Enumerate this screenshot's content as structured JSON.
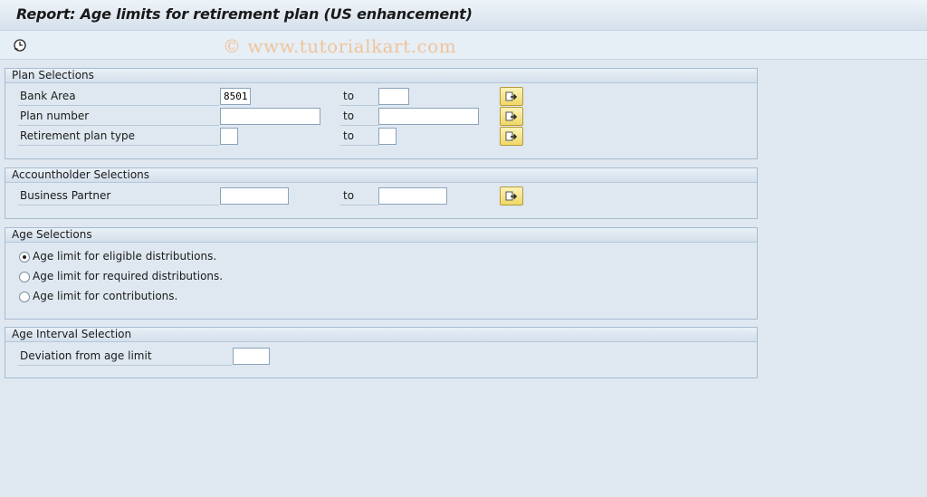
{
  "window": {
    "title": "Report: Age limits for retirement plan (US enhancement)",
    "watermark": "© www.tutorialkart.com"
  },
  "toolbar": {
    "execute_icon": "execute-clock-icon"
  },
  "plan_selections": {
    "header": "Plan Selections",
    "rows": [
      {
        "label": "Bank Area",
        "from_value": "8501",
        "to_label": "to",
        "to_value": ""
      },
      {
        "label": "Plan number",
        "from_value": "",
        "to_label": "to",
        "to_value": ""
      },
      {
        "label": "Retirement plan type",
        "from_value": "",
        "to_label": "to",
        "to_value": ""
      }
    ]
  },
  "accountholder_selections": {
    "header": "Accountholder Selections",
    "rows": [
      {
        "label": "Business Partner",
        "from_value": "",
        "to_label": "to",
        "to_value": ""
      }
    ]
  },
  "age_selections": {
    "header": "Age Selections",
    "options": [
      {
        "label": "Age limit for eligible distributions.",
        "selected": true
      },
      {
        "label": "Age limit for required distributions.",
        "selected": false
      },
      {
        "label": "Age limit for contributions.",
        "selected": false
      }
    ]
  },
  "age_interval_selection": {
    "header": "Age Interval Selection",
    "deviation_label": "Deviation from age limit",
    "deviation_value": ""
  },
  "icons": {
    "multiple_selection": "multiple-selection-arrow-icon"
  },
  "colors": {
    "background": "#dfe8f1",
    "button_yellow": "#efd867",
    "watermark": "#f0c49a"
  }
}
